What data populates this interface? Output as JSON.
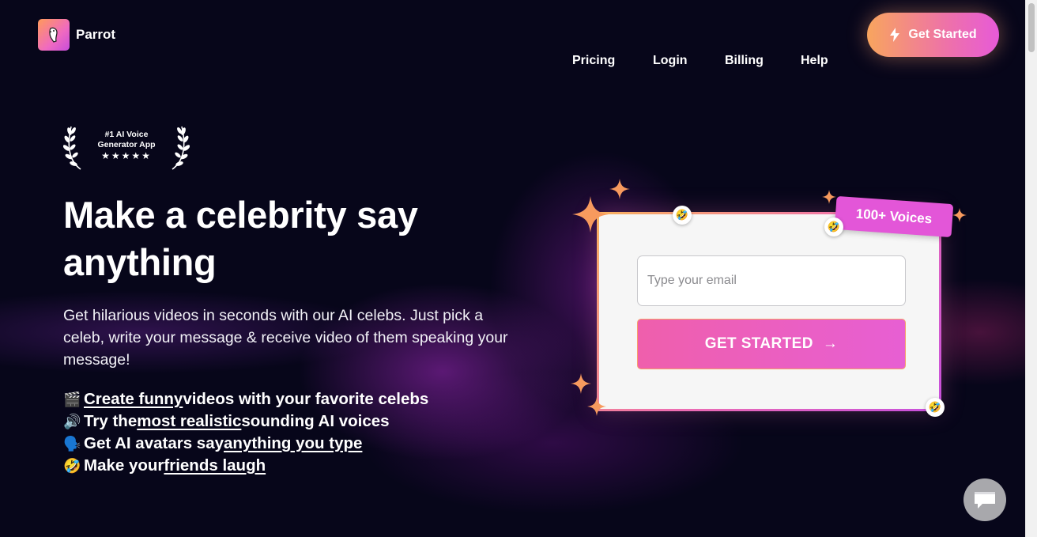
{
  "brand": {
    "name": "Parrot",
    "accent_gradient": [
      "#f8a55e",
      "#ee72a8",
      "#e75ad8"
    ]
  },
  "nav": {
    "items": [
      {
        "label": "Pricing"
      },
      {
        "label": "Login"
      },
      {
        "label": "Billing"
      },
      {
        "label": "Help"
      }
    ],
    "cta_label": "Get Started"
  },
  "award": {
    "line1": "#1 AI Voice",
    "line2": "Generator App",
    "stars": "★★★★★"
  },
  "hero": {
    "headline_line1": "Make a celebrity say",
    "headline_line2": "anything",
    "subtext": "Get hilarious videos in seconds with our AI celebs. Just pick a celeb, write your message & receive video of them speaking your message!"
  },
  "features": [
    {
      "icon": "🎬",
      "pre": "",
      "link": "Create funny",
      "post": " videos with your favorite celebs"
    },
    {
      "icon": "🔊",
      "pre": "Try the ",
      "link": "most realistic",
      "post": " sounding AI voices"
    },
    {
      "icon": "🗣️",
      "pre": "Get AI avatars say ",
      "link": "anything you type",
      "post": ""
    },
    {
      "icon": "🤣",
      "pre": "Make your ",
      "link": "friends laugh",
      "post": ""
    }
  ],
  "form": {
    "email_placeholder": "Type your email",
    "submit_label": "GET STARTED",
    "submit_arrow": "→",
    "tag_label": "100+ Voices"
  },
  "decor": {
    "emoji": "🤣",
    "sparkle_color": "#f79a5e"
  }
}
